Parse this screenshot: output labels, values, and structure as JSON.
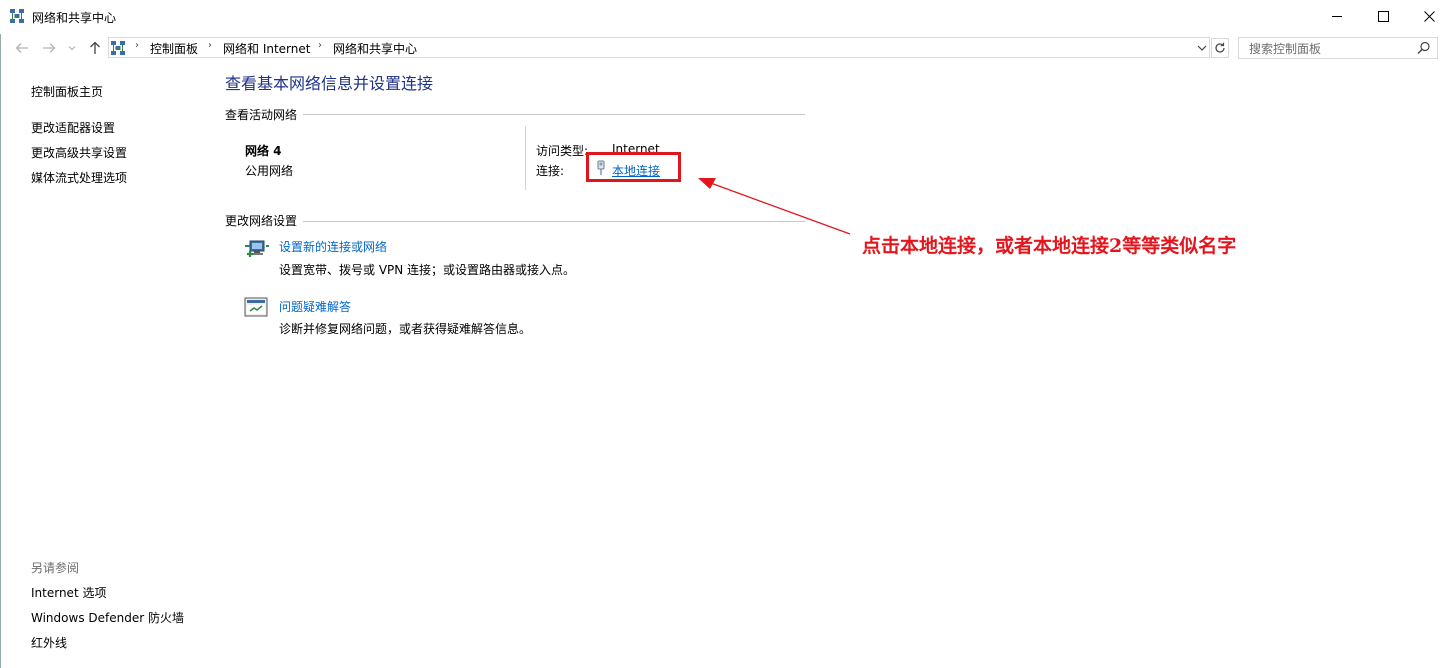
{
  "window": {
    "title": "网络和共享中心"
  },
  "address_bar": {
    "breadcrumbs": [
      "控制面板",
      "网络和 Internet",
      "网络和共享中心"
    ],
    "search_placeholder": "搜索控制面板"
  },
  "sidebar": {
    "home": "控制面板主页",
    "items": [
      "更改适配器设置",
      "更改高级共享设置",
      "媒体流式处理选项"
    ],
    "see_also_title": "另请参阅",
    "see_also": [
      "Internet 选项",
      "Windows Defender 防火墙",
      "红外线"
    ]
  },
  "main": {
    "title": "查看基本网络信息并设置连接",
    "active_networks_header": "查看活动网络",
    "network": {
      "name": "网络 4",
      "type": "公用网络",
      "access_type_label": "访问类型:",
      "access_type_value": "Internet",
      "connection_label": "连接:",
      "connection_value": "本地连接"
    },
    "change_settings_header": "更改网络设置",
    "tasks": [
      {
        "title": "设置新的连接或网络",
        "desc": "设置宽带、拨号或 VPN 连接；或设置路由器或接入点。"
      },
      {
        "title": "问题疑难解答",
        "desc": "诊断并修复网络问题，或者获得疑难解答信息。"
      }
    ]
  },
  "annotation": {
    "text": "点击本地连接，或者本地连接2等等类似名字",
    "color": "#e3161d"
  },
  "colors": {
    "title_blue": "#1e3287",
    "link_blue": "#0066cc"
  }
}
